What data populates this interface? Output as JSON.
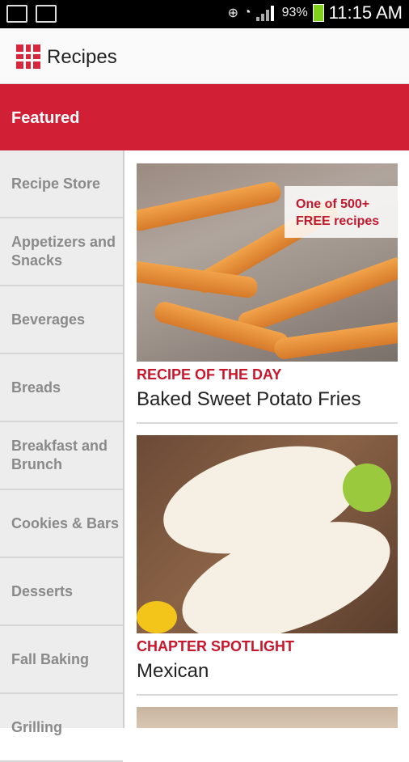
{
  "status_bar": {
    "battery_percent": "93%",
    "time": "11:15 AM",
    "icons": [
      "image-icon",
      "mail-icon",
      "gps-icon",
      "wifi-icon",
      "signal-icon",
      "battery-icon"
    ]
  },
  "header": {
    "title": "Recipes",
    "logo_color": "#d8273c"
  },
  "featured_tab": {
    "label": "Featured",
    "color": "#d11f35"
  },
  "sidebar": {
    "items": [
      {
        "label": "Recipe Store"
      },
      {
        "label": "Appetizers and Snacks"
      },
      {
        "label": "Beverages"
      },
      {
        "label": "Breads"
      },
      {
        "label": "Breakfast and Brunch"
      },
      {
        "label": "Cookies & Bars"
      },
      {
        "label": "Desserts"
      },
      {
        "label": "Fall Baking"
      },
      {
        "label": "Grilling"
      }
    ]
  },
  "main": {
    "cards": [
      {
        "badge": "One of 500+ FREE recipes",
        "kicker": "RECIPE OF THE DAY",
        "title": "Baked Sweet Potato Fries"
      },
      {
        "kicker": "CHAPTER SPOTLIGHT",
        "title": "Mexican"
      }
    ]
  }
}
